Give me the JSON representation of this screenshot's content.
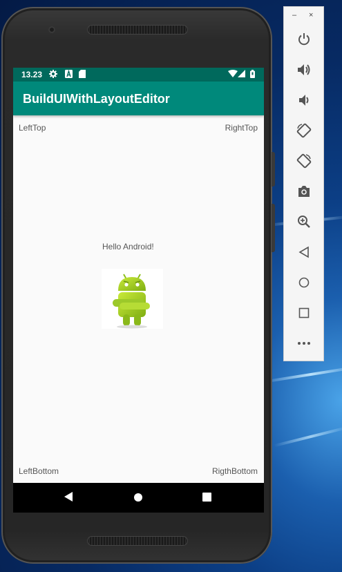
{
  "statusbar": {
    "time": "13.23",
    "icons": [
      "gear-icon",
      "a-notification-icon",
      "sd-card-icon",
      "wifi-icon",
      "signal-icon",
      "battery-icon"
    ]
  },
  "appbar": {
    "title": "BuildUIWithLayoutEditor"
  },
  "content": {
    "left_top": "LeftTop",
    "right_top": "RightTop",
    "hello": "Hello Android!",
    "left_bottom": "LeftBottom",
    "right_bottom": "RigthBottom",
    "image": "android-mascot-image"
  },
  "navbar": {
    "buttons": [
      "back-icon",
      "home-icon",
      "recents-icon"
    ]
  },
  "emulator_toolbar": {
    "window_controls": {
      "minimize": "–",
      "close": "×"
    },
    "buttons": [
      "power-icon",
      "volume-up-icon",
      "volume-down-icon",
      "rotate-left-icon",
      "rotate-right-icon",
      "camera-icon",
      "zoom-icon",
      "back-icon",
      "home-icon",
      "overview-icon",
      "more-icon"
    ]
  },
  "colors": {
    "status_bar": "#00695c",
    "app_bar": "#00897b",
    "screen_bg": "#fafafa",
    "desktop_bg": "#0c3f86"
  }
}
